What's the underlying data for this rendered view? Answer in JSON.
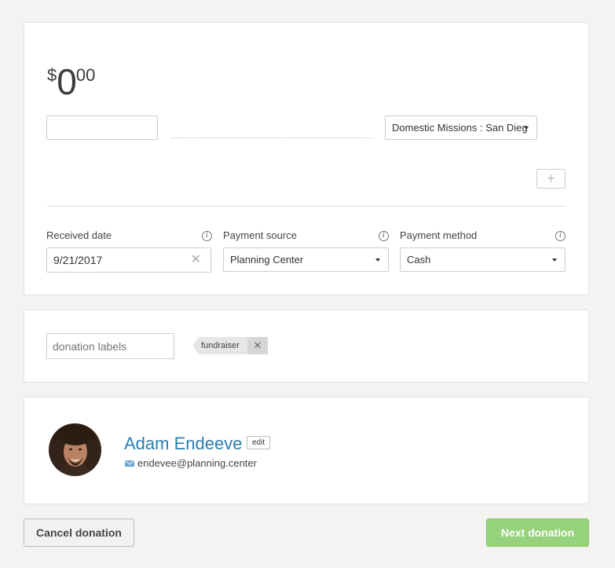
{
  "amount": {
    "currency": "$",
    "whole": "0",
    "cents": "00"
  },
  "fund": {
    "amount_value": "",
    "selected": "Domestic Missions : San Dieg"
  },
  "add_button_label": "+",
  "received_date": {
    "label": "Received date",
    "value": "9/21/2017"
  },
  "payment_source": {
    "label": "Payment source",
    "selected": "Planning Center"
  },
  "payment_method": {
    "label": "Payment method",
    "selected": "Cash"
  },
  "labels": {
    "placeholder": "donation labels",
    "tags": [
      "fundraiser"
    ]
  },
  "donor": {
    "name": "Adam Endeeve",
    "edit_label": "edit",
    "email": "endevee@planning.center"
  },
  "actions": {
    "cancel_label": "Cancel donation",
    "next_label": "Next donation"
  },
  "colors": {
    "link": "#2a7eb3",
    "primary_button": "#96d17b",
    "background": "#f4f3f1"
  },
  "icons": [
    "info-icon",
    "clear-icon",
    "remove-tag-icon",
    "mail-icon",
    "caret-down-icon",
    "plus-icon"
  ]
}
